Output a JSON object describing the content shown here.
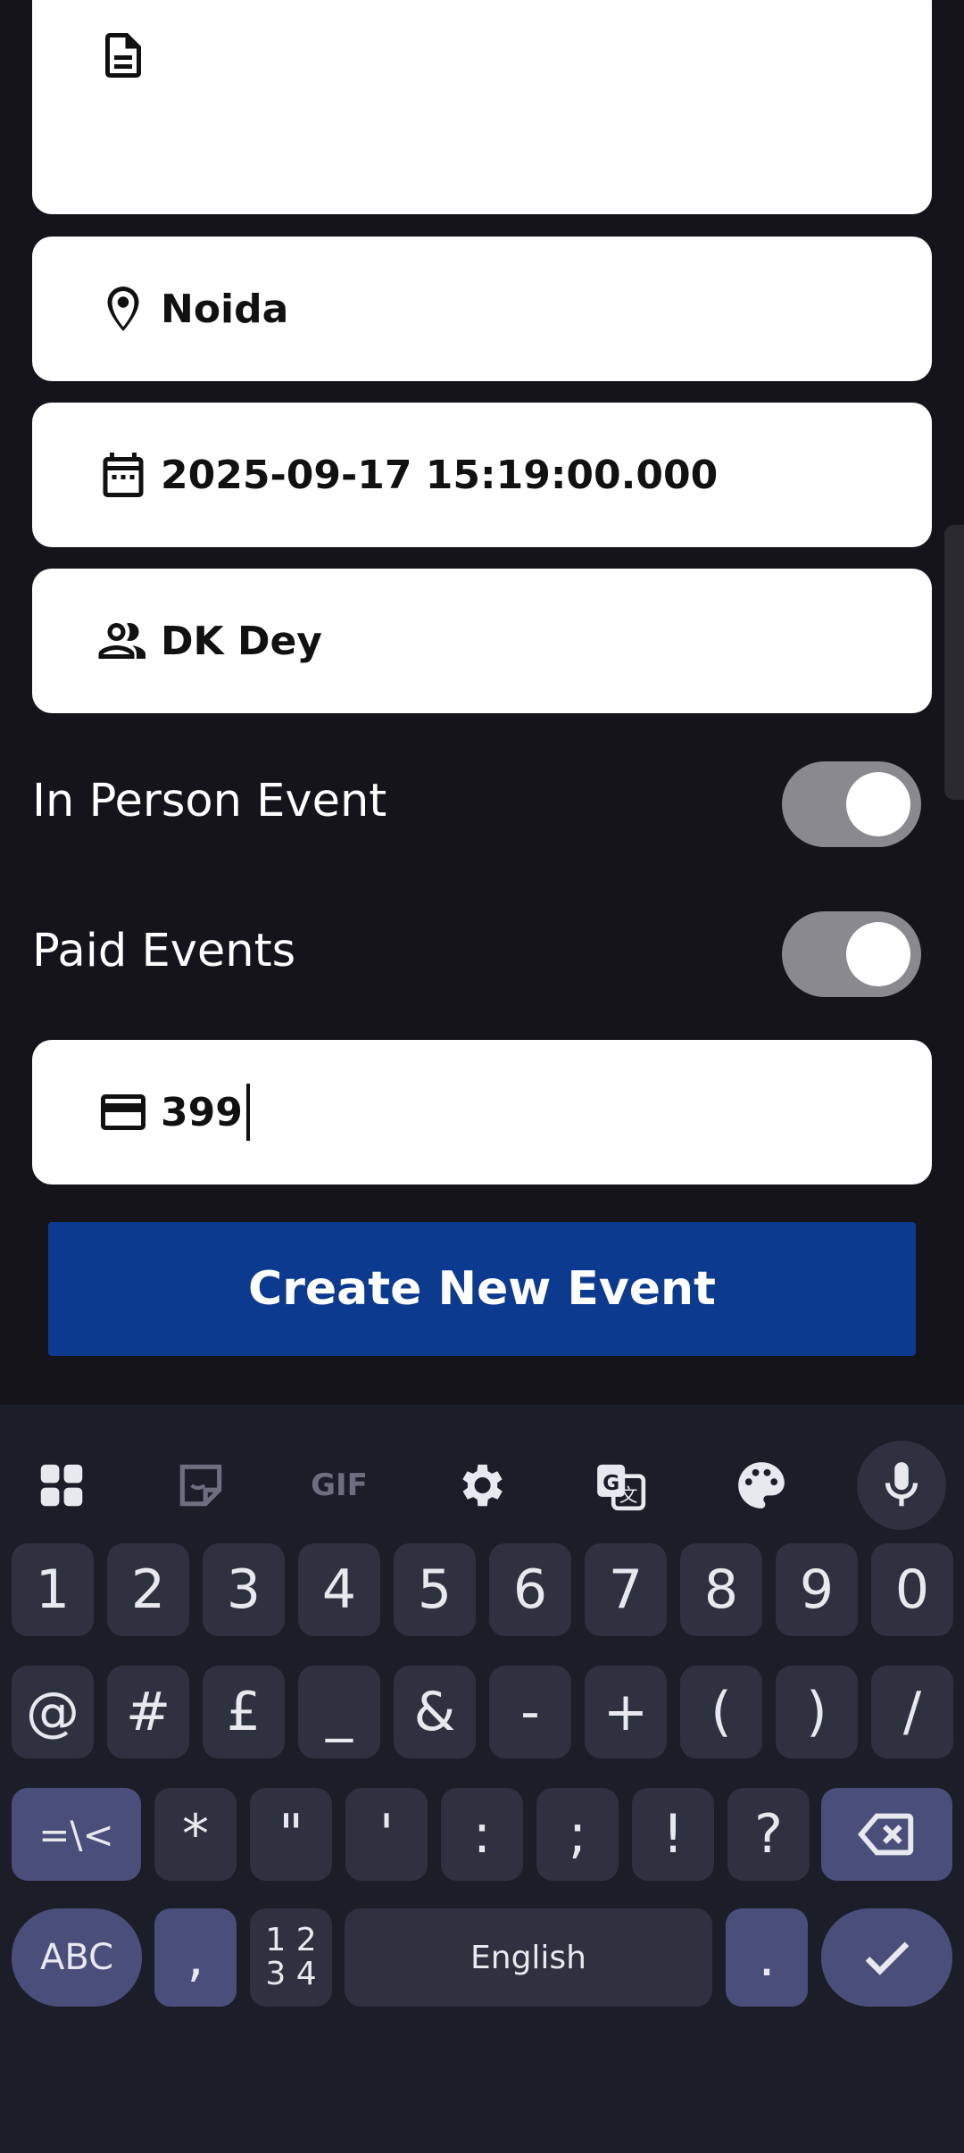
{
  "form": {
    "location_value": "Noida",
    "datetime_value": "2025-09-17 15:19:00.000",
    "organizer_value": "DK Dey",
    "in_person_label": "In Person Event",
    "paid_label": "Paid Events",
    "price_value": "399",
    "create_button_label": "Create New Event"
  },
  "keyboard": {
    "toolbar_icons": [
      "apps-icon",
      "sticker-icon",
      "gif-icon",
      "settings-icon",
      "translate-icon",
      "palette-icon",
      "mic-icon"
    ],
    "gif_label": "GIF",
    "number_row": [
      "1",
      "2",
      "3",
      "4",
      "5",
      "6",
      "7",
      "8",
      "9",
      "0"
    ],
    "symbol_row": [
      "@",
      "#",
      "£",
      "_",
      "&",
      "-",
      "+",
      "(",
      ")",
      "/"
    ],
    "third_row": [
      "*",
      "\"",
      "'",
      ":",
      ";",
      "!",
      "?"
    ],
    "more_symbols_label": "=\\<",
    "abc_label": "ABC",
    "comma_label": ",",
    "num_layout_label_top": "1 2",
    "num_layout_label_bottom": "3 4",
    "space_label": "English",
    "period_label": "."
  },
  "colors": {
    "background": "#15141a",
    "button_blue": "#0c3a8f",
    "keyboard_bg": "#1b1d29",
    "key_bg": "#2e313f",
    "key_alt_bg": "#4a4e7a"
  }
}
